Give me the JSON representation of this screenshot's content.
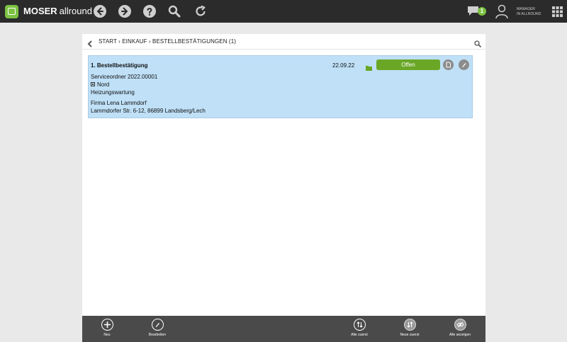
{
  "app": {
    "brand_bold": "MOSER",
    "brand_rest": "allround",
    "brand_color": "#7cc242"
  },
  "topbar": {
    "nav_icons": [
      "back-arrow-icon",
      "forward-arrow-icon",
      "help-icon",
      "search-icon",
      "refresh-icon"
    ],
    "chat_badge_count": "1",
    "user_line1": "MANAGER",
    "user_line2": "IN ALLROUND"
  },
  "breadcrumb": {
    "text": "START › EINKAUF › BESTELLBESTÄTIGUNGEN  (1)"
  },
  "record": {
    "title": "1. Bestellbestätigung",
    "date": "22.09.22",
    "status": "Offen",
    "status_color": "#6aa727",
    "line_order": "Serviceordner 2022.00001",
    "line_region": "Nord",
    "line_service": "Heizungswartung",
    "line_company": "Firma Lena Lammdorf",
    "line_address": "Lammdorfer Str. 6-12, 86899 Landsberg/Lech",
    "highlight_color": "#bfe0f7"
  },
  "toolbar": {
    "new_label": "Neu",
    "edit_label": "Bearbeiten",
    "oldest_first_label": "Alte zuerst",
    "newest_first_label": "Neue zuerst",
    "show_all_label": "Alle anzeigen"
  }
}
